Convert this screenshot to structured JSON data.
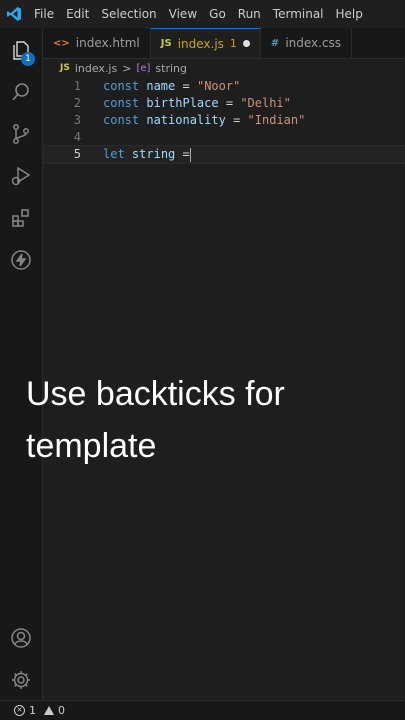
{
  "menu": [
    "File",
    "Edit",
    "Selection",
    "View",
    "Go",
    "Run",
    "Terminal",
    "Help"
  ],
  "activity_bar": {
    "explorer_badge": "1",
    "icons": [
      "files-icon",
      "search-icon",
      "source-control-icon",
      "run-debug-icon",
      "extensions-icon",
      "lightning-icon",
      "account-icon",
      "settings-gear-icon"
    ]
  },
  "tabs": [
    {
      "icon": "<>",
      "label": "index.html"
    },
    {
      "icon": "JS",
      "label": "index.js",
      "problems": "1",
      "modified": true
    },
    {
      "icon": "#",
      "label": "index.css"
    }
  ],
  "breadcrumb": {
    "file_icon": "JS",
    "file": "index.js",
    "separator": ">",
    "symbol_icon": "[e]",
    "symbol": "string"
  },
  "editor": {
    "lines": [
      {
        "num": "1",
        "kw": "const",
        "name": "name",
        "eq": "=",
        "value": "\"Noor\""
      },
      {
        "num": "2",
        "kw": "const",
        "name": "birthPlace",
        "eq": "=",
        "value": "\"Delhi\""
      },
      {
        "num": "3",
        "kw": "const",
        "name": "nationality",
        "eq": "=",
        "value": "\"Indian\""
      },
      {
        "num": "4"
      },
      {
        "num": "5",
        "kw": "let",
        "name": "string",
        "eq": "="
      }
    ]
  },
  "caption": "Use backticks for template",
  "statusbar": {
    "errors": "1",
    "warnings": "0"
  },
  "colors": {
    "accent": "#0078d4",
    "keyword": "#569cd6",
    "variable": "#9cdcfe",
    "string": "#ce9178"
  }
}
